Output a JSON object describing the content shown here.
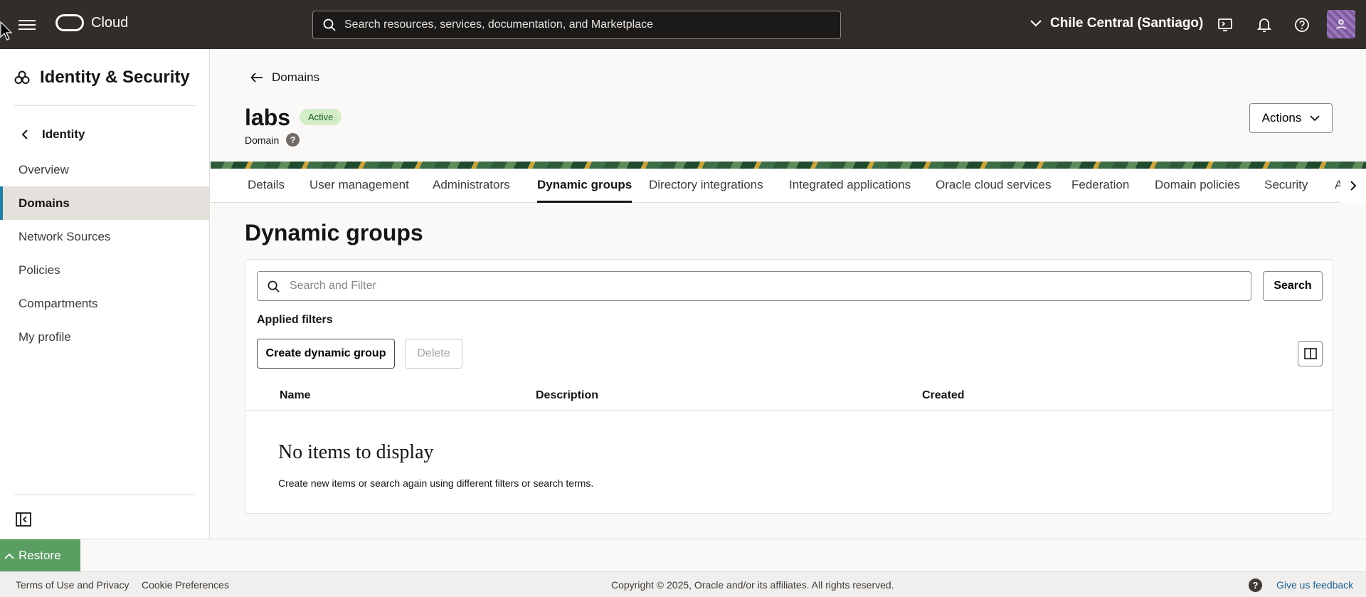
{
  "header": {
    "brand": "Cloud",
    "search_placeholder": "Search resources, services, documentation, and Marketplace",
    "region": "Chile Central (Santiago)"
  },
  "sidebar": {
    "title": "Identity & Security",
    "back_label": "Identity",
    "items": [
      {
        "label": "Overview",
        "active": false
      },
      {
        "label": "Domains",
        "active": true
      },
      {
        "label": "Network Sources",
        "active": false
      },
      {
        "label": "Policies",
        "active": false
      },
      {
        "label": "Compartments",
        "active": false
      },
      {
        "label": "My profile",
        "active": false
      }
    ]
  },
  "main": {
    "breadcrumb": "Domains",
    "title": "labs",
    "status": "Active",
    "subtitle": "Domain",
    "help_mark": "?",
    "actions_label": "Actions",
    "tabs": [
      {
        "label": "Details",
        "active": false
      },
      {
        "label": "User management",
        "active": false
      },
      {
        "label": "Administrators",
        "active": false
      },
      {
        "label": "Dynamic groups",
        "active": true
      },
      {
        "label": "Directory integrations",
        "active": false
      },
      {
        "label": "Integrated applications",
        "active": false
      },
      {
        "label": "Oracle cloud services",
        "active": false
      },
      {
        "label": "Federation",
        "active": false
      },
      {
        "label": "Domain policies",
        "active": false
      },
      {
        "label": "Security",
        "active": false
      },
      {
        "label": "A",
        "active": false
      }
    ],
    "section_title": "Dynamic groups",
    "filter_placeholder": "Search and Filter",
    "search_button": "Search",
    "applied_filters": "Applied filters",
    "create_button": "Create dynamic group",
    "delete_button": "Delete",
    "table": {
      "columns": [
        "Name",
        "Description",
        "Created"
      ],
      "empty_title": "No items to display",
      "empty_text": "Create new items or search again using different filters or search terms."
    }
  },
  "restore": {
    "label": "Restore"
  },
  "footer": {
    "terms": "Terms of Use and Privacy",
    "cookies": "Cookie Preferences",
    "copyright": "Copyright © 2025, Oracle and/or its affiliates. All rights reserved.",
    "help_mark": "?",
    "feedback": "Give us feedback"
  },
  "colors": {
    "header_bg": "#312d2a",
    "active_nav_accent": "#227e9e",
    "status_badge_bg": "#d4edc9",
    "restore_bg": "#5b9e62",
    "feedback_link": "#1a5d8f"
  }
}
